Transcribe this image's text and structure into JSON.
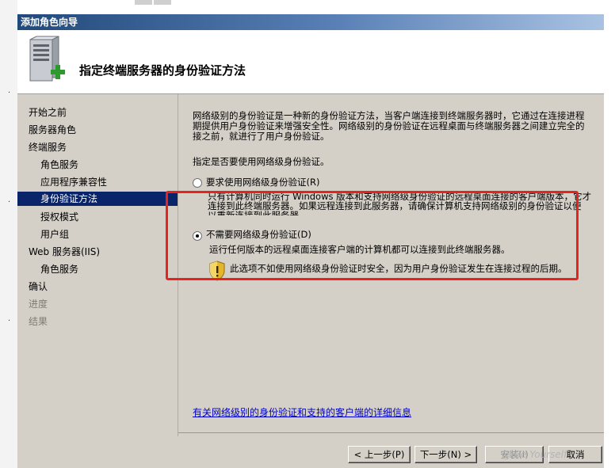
{
  "window": {
    "title": "添加角色向导"
  },
  "header": {
    "title": "指定终端服务器的身份验证方法"
  },
  "nav": {
    "items": [
      {
        "label": "开始之前",
        "level": 1,
        "state": "normal"
      },
      {
        "label": "服务器角色",
        "level": 1,
        "state": "normal"
      },
      {
        "label": "终端服务",
        "level": 1,
        "state": "normal"
      },
      {
        "label": "角色服务",
        "level": 2,
        "state": "normal"
      },
      {
        "label": "应用程序兼容性",
        "level": 2,
        "state": "normal"
      },
      {
        "label": "身份验证方法",
        "level": 2,
        "state": "active"
      },
      {
        "label": "授权模式",
        "level": 2,
        "state": "normal"
      },
      {
        "label": "用户组",
        "level": 2,
        "state": "normal"
      },
      {
        "label": "Web 服务器(IIS)",
        "level": 1,
        "state": "normal"
      },
      {
        "label": "角色服务",
        "level": 2,
        "state": "normal"
      },
      {
        "label": "确认",
        "level": 1,
        "state": "normal"
      },
      {
        "label": "进度",
        "level": 1,
        "state": "disabled"
      },
      {
        "label": "结果",
        "level": 1,
        "state": "disabled"
      }
    ]
  },
  "content": {
    "intro": [
      "网络级别的身份验证是一种新的身份验证方法，当客户端连接到终端服务器时，它通过在连接进程",
      "期提供用户身份验证来增强安全性。网络级别的身份验证在远程桌面与终端服务器之间建立完全的",
      "接之前，就进行了用户身份验证。"
    ],
    "prompt": "指定是否要使用网络级身份验证。",
    "option_require": {
      "label": "要求使用网络级身份验证(R)",
      "selected": false,
      "desc": [
        "只有计算机同时运行 Windows 版本和支持网络级身份验证的远程桌面连接的客户端版本，它才",
        "连接到此终端服务器。如果远程连接到此服务器，请确保计算机支持网络级别的身份验证以便",
        "以重新连接到此服务器。"
      ]
    },
    "option_no_require": {
      "label": "不需要网络级身份验证(D)",
      "selected": true,
      "desc": "运行任何版本的远程桌面连接客户端的计算机都可以连接到此终端服务器。",
      "warning": "此选项不如使用网络级身份验证时安全，因为用户身份验证发生在连接过程的后期。"
    },
    "link": "有关网络级别的身份验证和支持的客户端的详细信息"
  },
  "buttons": {
    "back": "< 上一步(P)",
    "next": "下一步(N) >",
    "install": "安装(I)",
    "cancel": "取消"
  },
  "watermark": "@ Be Yourself",
  "colors": {
    "highlight": "#e8221c",
    "nav_active": "#0a246a",
    "link": "#0000cc"
  }
}
